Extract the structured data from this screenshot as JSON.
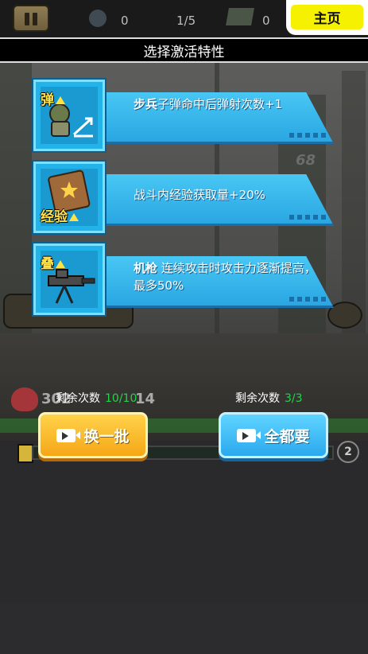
{
  "hud": {
    "stage": "1/5",
    "coin_count": "0",
    "cash_count": "0",
    "home_label": "主页",
    "score_ghost": "68"
  },
  "panel": {
    "title": "选择激活特性"
  },
  "perks": [
    {
      "tag": "弹",
      "unit": "步兵",
      "desc": "子弹命中后弹射次数+1",
      "icon": "soldier-icon"
    },
    {
      "tag": "经验",
      "unit": "",
      "desc": "战斗内经验获取量+20%",
      "icon": "experience-book-icon"
    },
    {
      "tag": "叠",
      "unit": "机枪",
      "desc": "连续攻击时攻击力逐渐提高，最多50%",
      "icon": "machine-gun-icon"
    }
  ],
  "status": {
    "hp_text": "302",
    "hp_right": "14",
    "level": "2"
  },
  "controls": {
    "refresh": {
      "remaining_label": "剩余次数",
      "remaining_count": "10/10",
      "button_label": "换一批"
    },
    "take_all": {
      "remaining_label": "剩余次数",
      "remaining_count": "3/3",
      "button_label": "全都要"
    }
  },
  "colors": {
    "accent_blue": "#2aa9ee",
    "accent_yellow": "#f5a717",
    "home_yellow": "#f6f100",
    "count_green": "#22d44a"
  }
}
